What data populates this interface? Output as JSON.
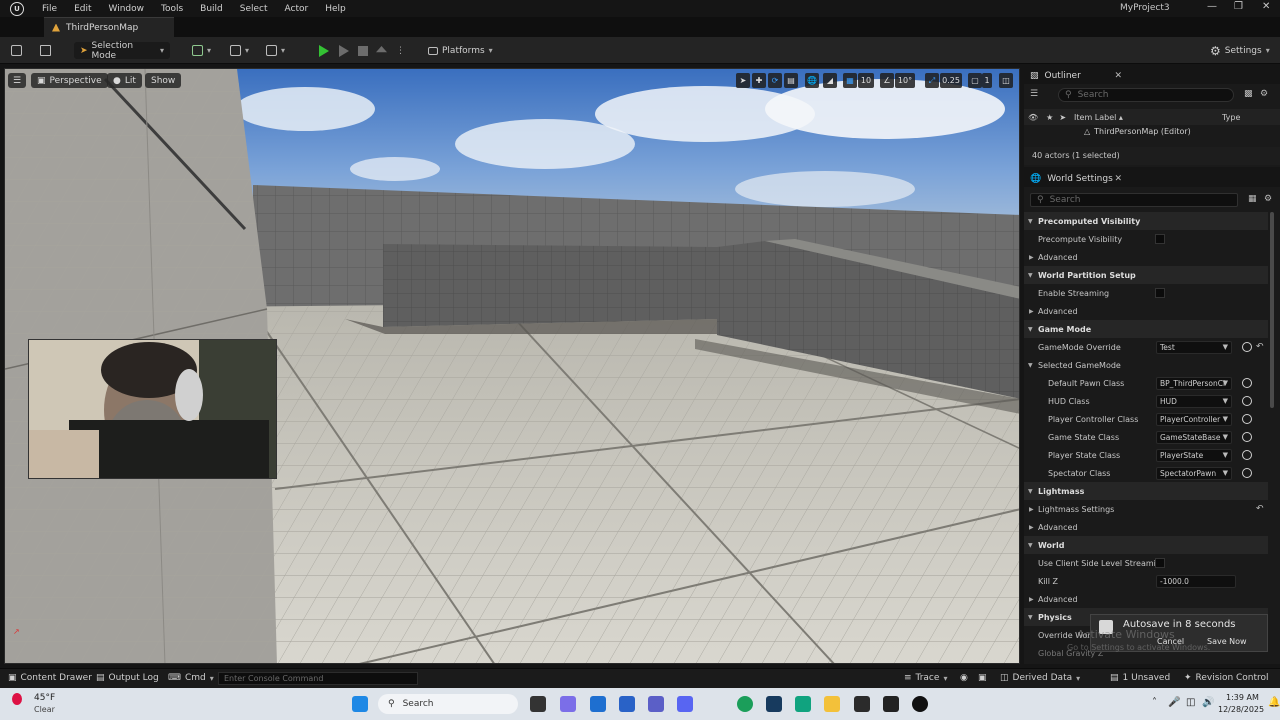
{
  "menubar": {
    "items": [
      "File",
      "Edit",
      "Window",
      "Tools",
      "Build",
      "Select",
      "Actor",
      "Help"
    ],
    "project_name": "MyProject3"
  },
  "tab": {
    "map_name": "ThirdPersonMap"
  },
  "toolbar": {
    "selection_mode": "Selection Mode",
    "platforms": "Platforms",
    "settings": "Settings"
  },
  "viewport": {
    "perspective": "Perspective",
    "lit": "Lit",
    "show": "Show",
    "grid_snap": "10",
    "rotation_snap": "10°",
    "scale_snap": "0.25",
    "camera_speed": "1"
  },
  "outliner": {
    "title": "Outliner",
    "search_placeholder": "Search",
    "col_item_label": "Item Label ▴",
    "col_type": "Type",
    "root_item": "ThirdPersonMap (Editor)",
    "status": "40 actors (1 selected)"
  },
  "world_settings": {
    "title": "World Settings",
    "search_placeholder": "Search",
    "rows": {
      "precomputed_visibility": "Precomputed Visibility",
      "precompute_visibility": "Precompute Visibility",
      "advanced": "Advanced",
      "world_partition_setup": "World Partition Setup",
      "enable_streaming": "Enable Streaming",
      "game_mode": "Game Mode",
      "gamemode_override": "GameMode Override",
      "gamemode_override_value": "Test",
      "selected_gamemode": "Selected GameMode",
      "default_pawn_class": "Default Pawn Class",
      "default_pawn_class_value": "BP_ThirdPersonCl",
      "hud_class": "HUD Class",
      "hud_class_value": "HUD",
      "player_controller_class": "Player Controller Class",
      "player_controller_class_value": "PlayerController",
      "game_state_class": "Game State Class",
      "game_state_class_value": "GameStateBase",
      "player_state_class": "Player State Class",
      "player_state_class_value": "PlayerState",
      "spectator_class": "Spectator Class",
      "spectator_class_value": "SpectatorPawn",
      "lightmass": "Lightmass",
      "lightmass_settings": "Lightmass Settings",
      "world": "World",
      "use_client_side_level_streaming": "Use Client Side Level Streami...",
      "kill_z": "Kill Z",
      "kill_z_value": "-1000.0",
      "physics": "Physics",
      "override_world_gravity": "Override World",
      "global_gravity": "Global Gravity Z"
    }
  },
  "toast": {
    "title": "Autosave in 8 seconds",
    "cancel": "Cancel",
    "save_now": "Save Now",
    "activate_windows": "Activate Windows",
    "activate_hint": "Go to Settings to activate Windows."
  },
  "bottombar": {
    "content_drawer": "Content Drawer",
    "output_log": "Output Log",
    "cmd": "Cmd",
    "console_placeholder": "Enter Console Command",
    "trace": "Trace",
    "derived_data": "Derived Data",
    "unsaved": "1 Unsaved",
    "revision_control": "Revision Control"
  },
  "taskbar": {
    "temperature": "45°F",
    "weather": "Clear",
    "search": "Search",
    "time": "1:39 AM",
    "date": "12/28/2025"
  }
}
